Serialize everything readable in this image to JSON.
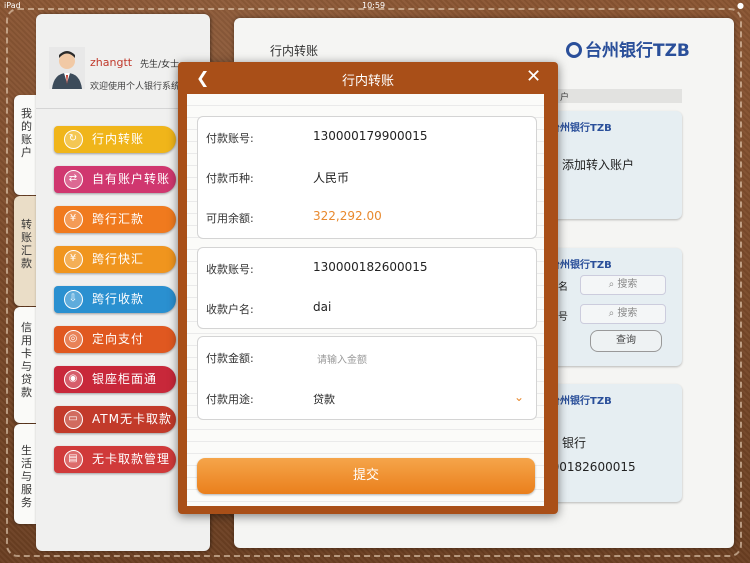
{
  "status_bar": {
    "left": "iPad",
    "time": "10:59",
    "battery": "●"
  },
  "profile": {
    "username": "zhangtt",
    "title": "先生/女士",
    "welcome": "欢迎使用个人银行系统"
  },
  "side_tabs": [
    {
      "label": "我的账户"
    },
    {
      "label": "转账汇款"
    },
    {
      "label": "信用卡与贷款"
    },
    {
      "label": "生活与服务"
    }
  ],
  "menu": [
    {
      "label": "行内转账",
      "color": "#f0b51a",
      "icon": "↻"
    },
    {
      "label": "自有账户转账",
      "color": "#d0376f",
      "icon": "⇄"
    },
    {
      "label": "跨行汇款",
      "color": "#f07a1e",
      "icon": "¥"
    },
    {
      "label": "跨行快汇",
      "color": "#f0951e",
      "icon": "¥"
    },
    {
      "label": "跨行收款",
      "color": "#2a90d0",
      "icon": "⇩"
    },
    {
      "label": "定向支付",
      "color": "#e05820",
      "icon": "◎"
    },
    {
      "label": "银座柜面通",
      "color": "#c8283a",
      "icon": "◉"
    },
    {
      "label": "ATM无卡取款",
      "color": "#c23a2a",
      "icon": "▭"
    },
    {
      "label": "无卡取款管理",
      "color": "#d03a3a",
      "icon": "▤"
    }
  ],
  "right_panel": {
    "title": "行内转账",
    "logo": "台州银行TZB",
    "strip_text": "户",
    "cards": [
      {
        "logo": "台州银行TZB",
        "text": "添加转入账户"
      },
      {
        "logo": "台州银行TZB",
        "name_label": "名",
        "no_label": "号",
        "search": "搜索",
        "query": "查询"
      },
      {
        "logo": "台州银行TZB",
        "bank": "银行",
        "account": "000182600015"
      }
    ]
  },
  "modal": {
    "title": "行内转账",
    "payer": [
      {
        "key": "付款账号:",
        "value": "130000179900015"
      },
      {
        "key": "付款币种:",
        "value": "人民币"
      },
      {
        "key": "可用余额:",
        "value": "322,292.00"
      }
    ],
    "payee": [
      {
        "key": "收款账号:",
        "value": "130000182600015"
      },
      {
        "key": "收款户名:",
        "value": "dai"
      }
    ],
    "amount": {
      "key": "付款金额:",
      "placeholder": "请输入金额"
    },
    "purpose": {
      "key": "付款用途:",
      "value": "贷款"
    },
    "submit": "提交"
  },
  "colors": {
    "accent_orange": "#ea7f1c",
    "balance": "#e8892e",
    "modal_frame": "#a94f18"
  }
}
